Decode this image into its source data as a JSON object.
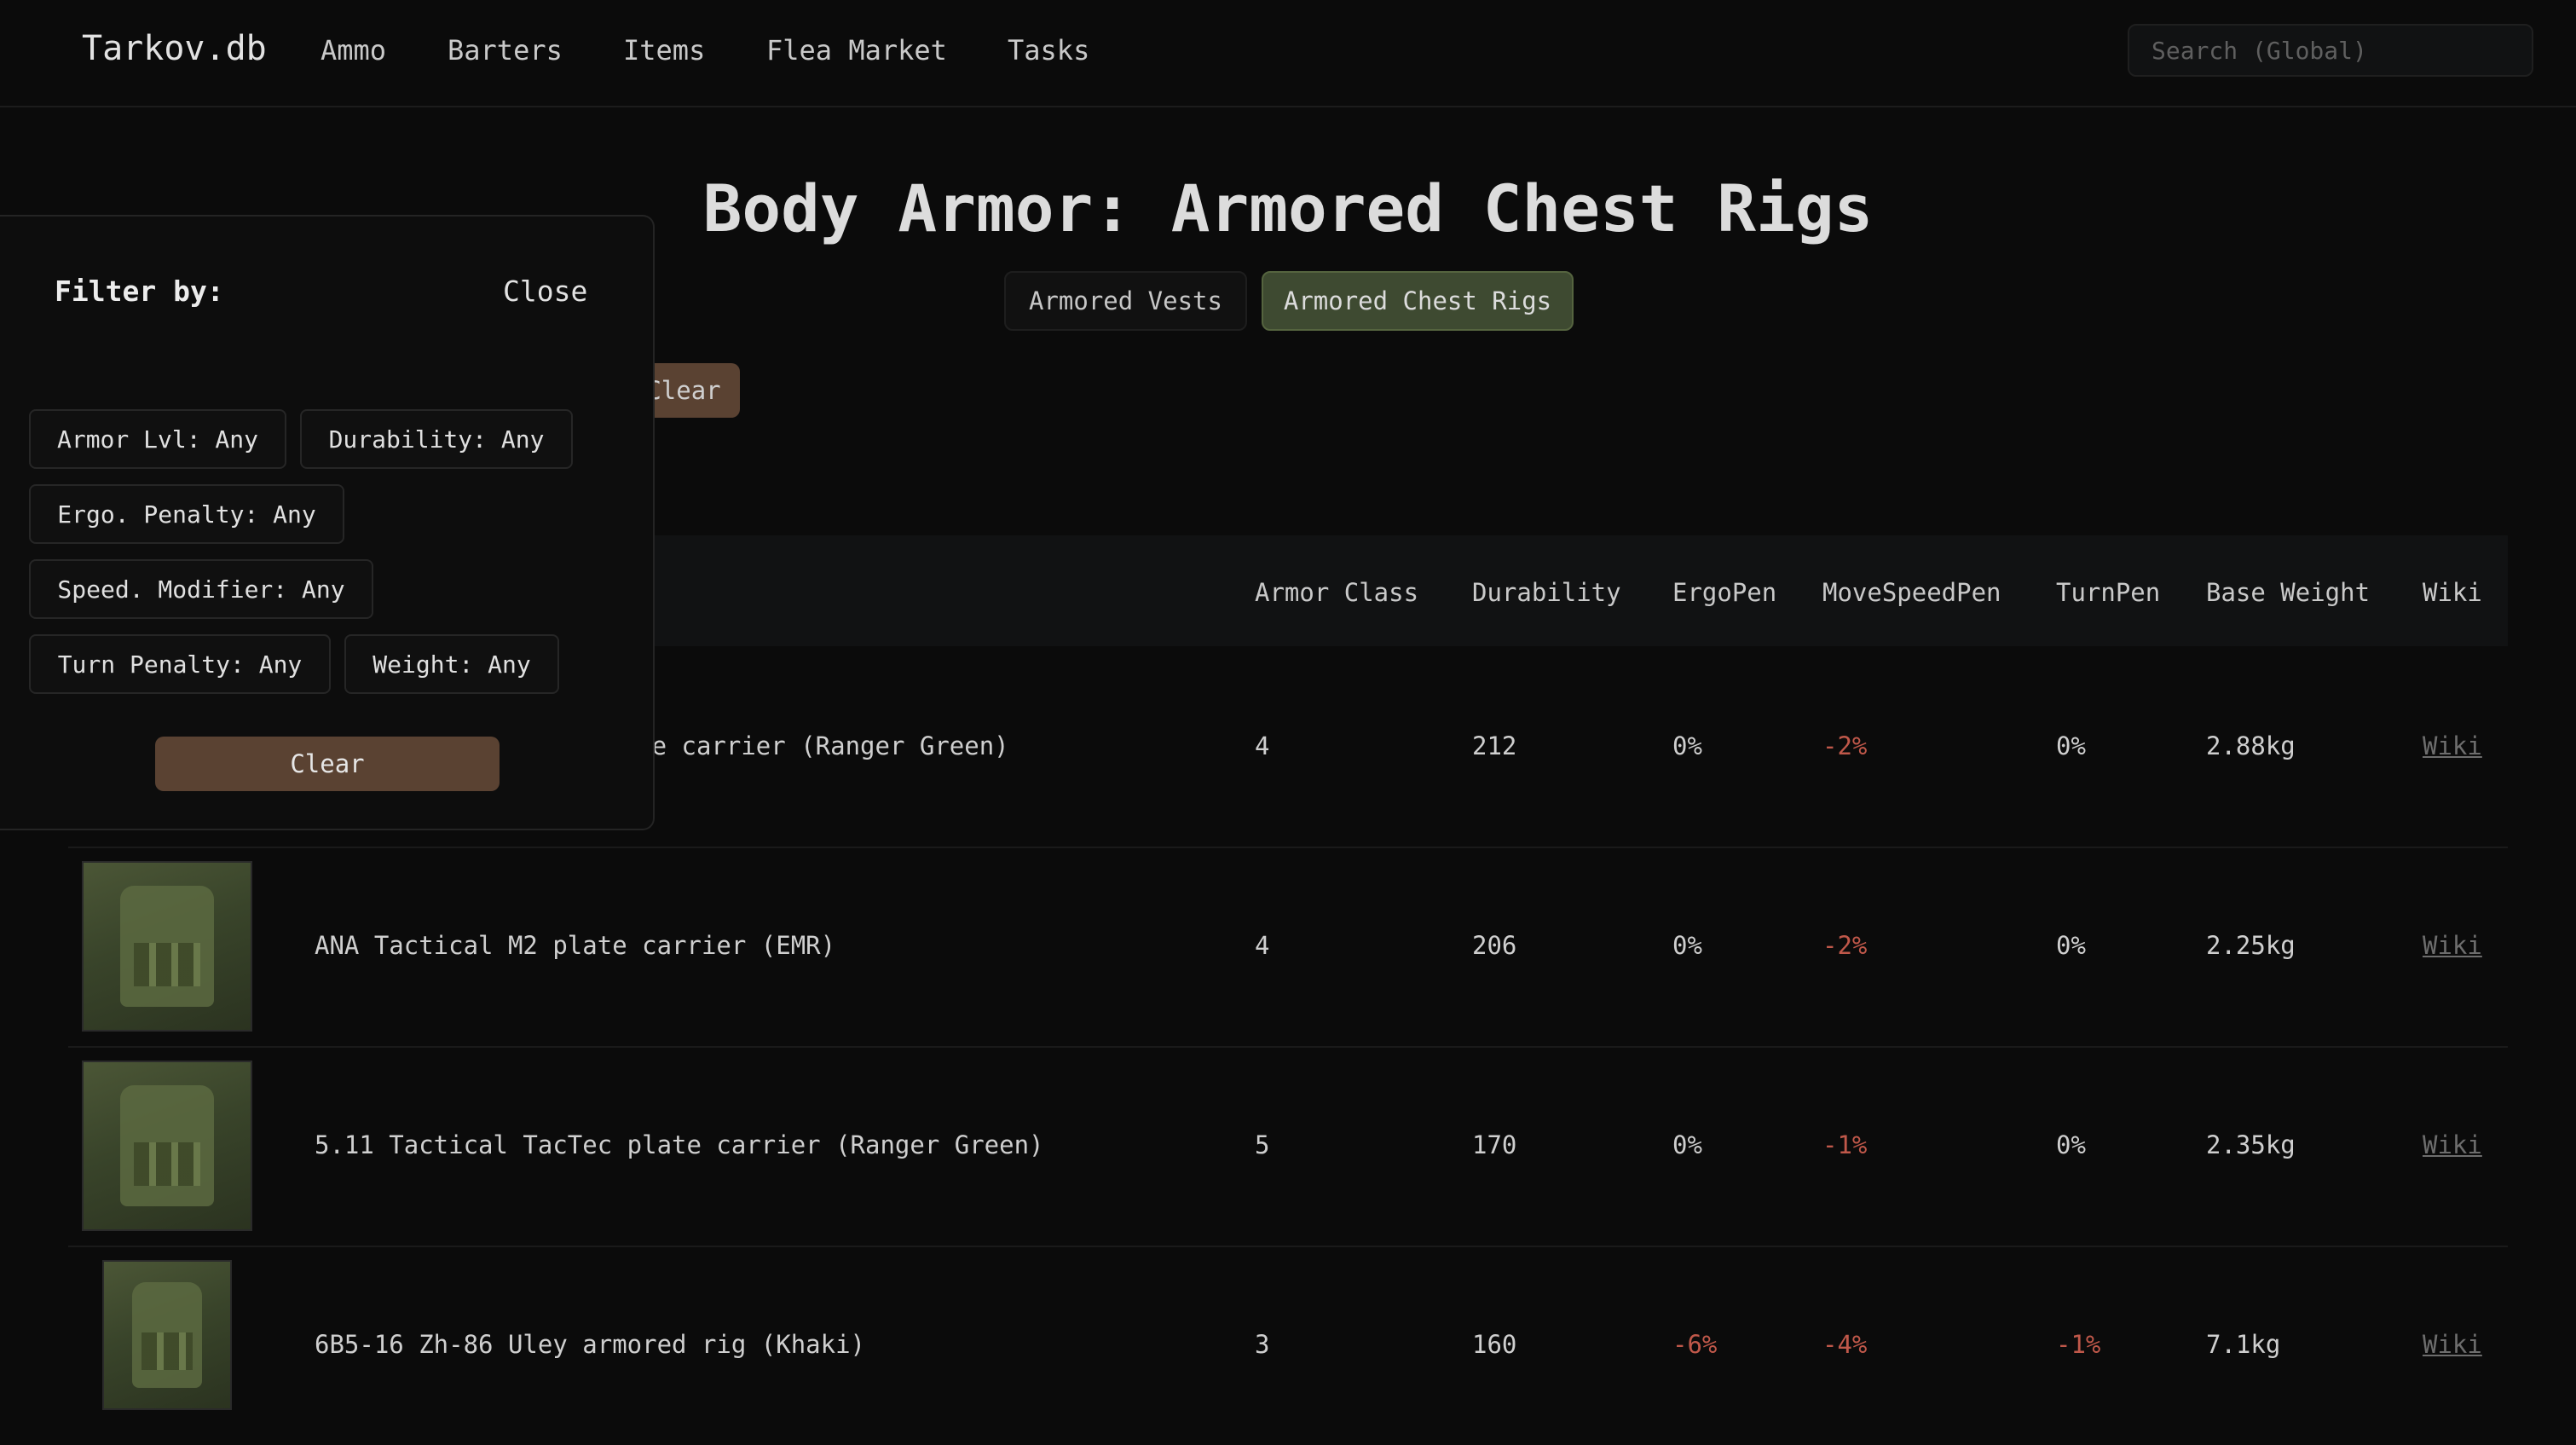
{
  "nav": {
    "brand": "Tarkov.db",
    "links": [
      "Ammo",
      "Barters",
      "Items",
      "Flea Market",
      "Tasks"
    ],
    "search_placeholder": "Search (Global)"
  },
  "page": {
    "title": "Body Armor: Armored Chest Rigs",
    "tabs": [
      {
        "label": "Armored Vests",
        "active": false
      },
      {
        "label": "Armored Chest Rigs",
        "active": true
      }
    ],
    "clear_label": "Clear"
  },
  "filter_panel": {
    "title": "Filter by:",
    "close_label": "Close",
    "chips": [
      "Armor Lvl: Any",
      "Durability: Any",
      "Ergo. Penalty: Any",
      "Speed. Modifier: Any",
      "Turn Penalty: Any",
      "Weight: Any"
    ],
    "clear_label": "Clear"
  },
  "table": {
    "columns": [
      "Armor Class",
      "Durability",
      "ErgoPen",
      "MoveSpeedPen",
      "TurnPen",
      "Base Weight",
      "Wiki"
    ],
    "rows": [
      {
        "name": "AVS plate carrier (Ranger Green)",
        "visible_name": "n AVS plate carrier (Ranger Green)",
        "armor_class": "4",
        "durability": "212",
        "ergo": "0%",
        "move": "-2%",
        "turn": "0%",
        "weight": "2.88kg",
        "wiki": "Wiki"
      },
      {
        "name": "ANA Tactical M2 plate carrier (EMR)",
        "armor_class": "4",
        "durability": "206",
        "ergo": "0%",
        "move": "-2%",
        "turn": "0%",
        "weight": "2.25kg",
        "wiki": "Wiki"
      },
      {
        "name": "5.11 Tactical TacTec plate carrier (Ranger Green)",
        "armor_class": "5",
        "durability": "170",
        "ergo": "0%",
        "move": "-1%",
        "turn": "0%",
        "weight": "2.35kg",
        "wiki": "Wiki"
      },
      {
        "name": "6B5-16 Zh-86 Uley armored rig (Khaki)",
        "armor_class": "3",
        "durability": "160",
        "ergo": "-6%",
        "move": "-4%",
        "turn": "-1%",
        "weight": "7.1kg",
        "wiki": "Wiki"
      }
    ]
  },
  "colors": {
    "background": "#0b0b0b",
    "active_tab": "#3e4a31",
    "clear_button": "#5a4232",
    "negative_value": "#c0584a"
  }
}
